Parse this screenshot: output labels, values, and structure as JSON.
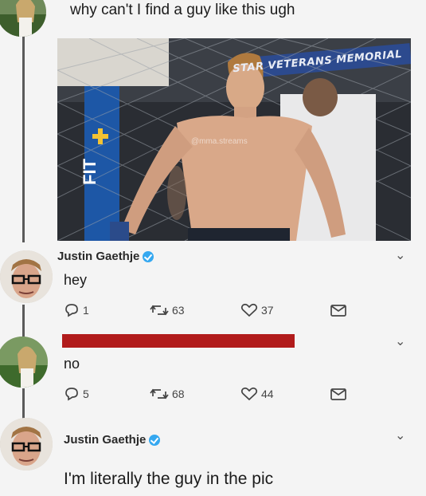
{
  "thread": {
    "tweet1": {
      "text": "why can't I find a guy like this ugh",
      "image": {
        "banner_text": "STAR VETERANS MEMORIAL",
        "watermark": "@mma.streams",
        "mat_text": "FIT"
      }
    },
    "reply1": {
      "name": "Justin Gaethje",
      "text": "hey",
      "replies": "1",
      "retweets": "63",
      "likes": "37"
    },
    "reply2": {
      "text": "no",
      "replies": "5",
      "retweets": "68",
      "likes": "44"
    },
    "reply3": {
      "name": "Justin Gaethje",
      "text": "I'm literally the guy in the pic"
    }
  },
  "icons": [
    "reply-icon",
    "retweet-icon",
    "like-icon",
    "share-icon",
    "chevron-down-icon",
    "verified-icon"
  ],
  "colors": {
    "background": "#f4f4f4",
    "verified": "#35a8f0",
    "redaction": "#b11b1b",
    "thread_line": "#5a5a5a"
  }
}
